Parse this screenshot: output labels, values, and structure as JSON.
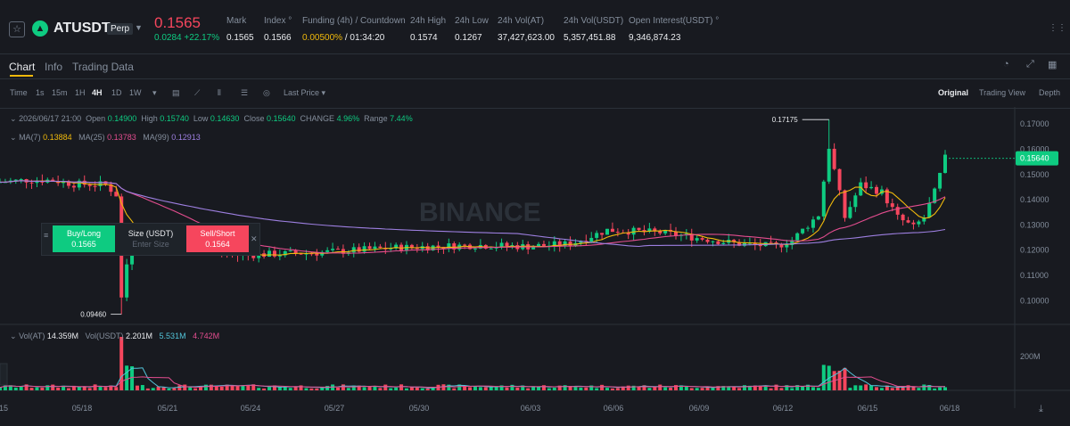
{
  "header": {
    "symbol": "ATUSDT",
    "contract_type": "Perp",
    "last_price": "0.1565",
    "change_abs": "0.0284",
    "change_pct": "+22.17%",
    "stats": [
      {
        "label": "Mark",
        "value": "0.1565"
      },
      {
        "label": "Index",
        "value": "0.1566"
      },
      {
        "label": "Funding (4h) / Countdown",
        "value": "0.00500%",
        "value2": "/ 01:34:20"
      },
      {
        "label": "24h High",
        "value": "0.1574"
      },
      {
        "label": "24h Low",
        "value": "0.1267"
      },
      {
        "label": "24h Vol(AT)",
        "value": "37,427,623.00"
      },
      {
        "label": "24h Vol(USDT)",
        "value": "5,357,451.88"
      },
      {
        "label": "Open Interest(USDT)",
        "value": "9,346,874.23"
      }
    ]
  },
  "tabs": [
    "Chart",
    "Info",
    "Trading Data"
  ],
  "toolbar": {
    "time_label": "Time",
    "intervals": [
      "1s",
      "15m",
      "1H",
      "4H",
      "1D",
      "1W"
    ],
    "active_interval": "4H",
    "price_type": "Last Price",
    "views": [
      "Original",
      "Trading View",
      "Depth"
    ],
    "active_view": "Original"
  },
  "ohlc": {
    "date": "2026/06/17 21:00",
    "open_label": "Open",
    "open": "0.14900",
    "high_label": "High",
    "high": "0.15740",
    "low_label": "Low",
    "low": "0.14630",
    "close_label": "Close",
    "close": "0.15640",
    "change_label": "CHANGE",
    "change": "4.96%",
    "range_label": "Range",
    "range": "7.44%"
  },
  "ma_legend": [
    {
      "label": "MA(7)",
      "value": "0.13884",
      "color": "#f0b90b"
    },
    {
      "label": "MA(25)",
      "value": "0.13783",
      "color": "#e34d8f"
    },
    {
      "label": "MA(99)",
      "value": "0.12913",
      "color": "#9d7fe0"
    }
  ],
  "vol_legend": {
    "vol_at_label": "Vol(AT)",
    "vol_at": "14.359M",
    "vol_usdt_label": "Vol(USDT)",
    "vol_usdt": "2.201M",
    "ma5": "5.531M",
    "ma10": "4.742M"
  },
  "trade_panel": {
    "buy_label": "Buy/Long",
    "buy_price": "0.1565",
    "size_label": "Size (USDT)",
    "size_placeholder": "Enter Size",
    "sell_label": "Sell/Short",
    "sell_price": "0.1564"
  },
  "watermark": "BINANCE",
  "colors": {
    "up": "#0ecb81",
    "down": "#f6465d",
    "accent": "#f0b90b"
  },
  "chart_data": {
    "type": "candlestick",
    "price_ticks": [
      "0.17000",
      "0.16000",
      "0.15000",
      "0.14000",
      "0.13000",
      "0.12000",
      "0.11000",
      "0.10000"
    ],
    "current_price_tag": "0.15640",
    "high_marker": "0.17175",
    "low_marker": "0.09460",
    "volume_tick": "200M",
    "x_ticks": [
      "15",
      "05/18",
      "05/21",
      "05/24",
      "05/27",
      "05/30",
      "06/03",
      "06/06",
      "06/09",
      "06/12",
      "06/15",
      "06/18"
    ],
    "ylim": [
      0.092,
      0.175
    ],
    "anchors": [
      [
        0,
        0.147
      ],
      [
        5,
        0.1478
      ],
      [
        10,
        0.1478
      ],
      [
        14,
        0.1462
      ],
      [
        20,
        0.146
      ],
      [
        22,
        0.142
      ],
      [
        23,
        0.101
      ],
      [
        25,
        0.128
      ],
      [
        35,
        0.123
      ],
      [
        45,
        0.118
      ],
      [
        60,
        0.119
      ],
      [
        75,
        0.121
      ],
      [
        90,
        0.122
      ],
      [
        100,
        0.1215
      ],
      [
        108,
        0.1225
      ],
      [
        115,
        0.128
      ],
      [
        125,
        0.127
      ],
      [
        135,
        0.124
      ],
      [
        140,
        0.1225
      ],
      [
        147,
        0.1215
      ],
      [
        150,
        0.124
      ],
      [
        155,
        0.134
      ],
      [
        157,
        0.161
      ],
      [
        160,
        0.133
      ],
      [
        163,
        0.146
      ],
      [
        167,
        0.143
      ],
      [
        170,
        0.133
      ],
      [
        173,
        0.129
      ],
      [
        175,
        0.133
      ],
      [
        177,
        0.143
      ],
      [
        179,
        0.1565
      ]
    ]
  }
}
